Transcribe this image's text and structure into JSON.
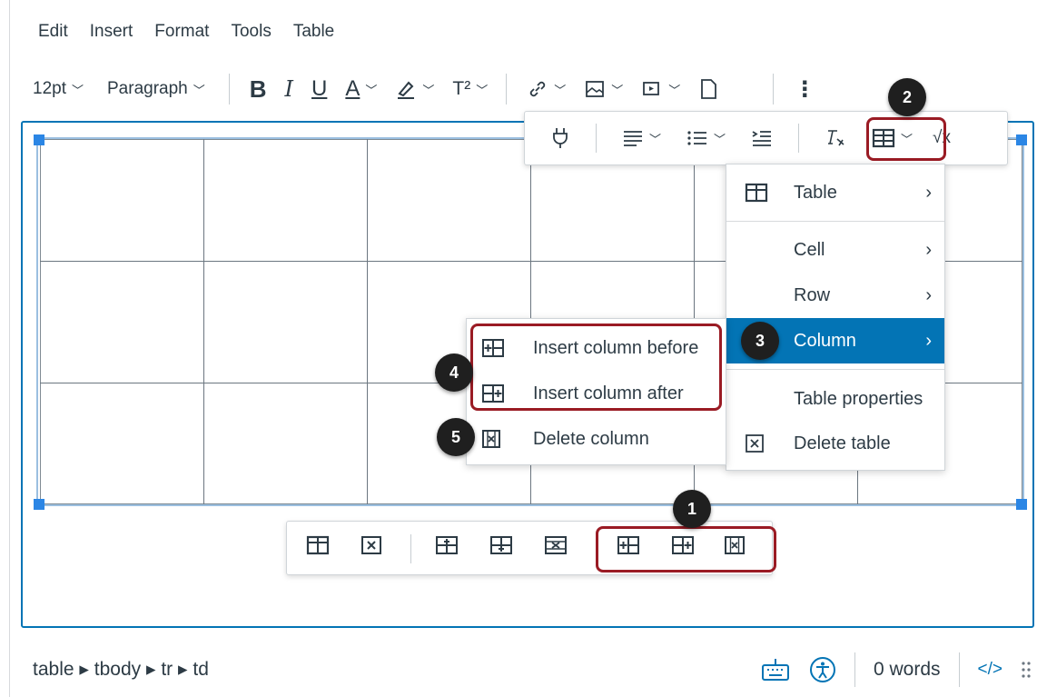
{
  "menubar": {
    "items": [
      "Edit",
      "Insert",
      "Format",
      "Tools",
      "Table"
    ]
  },
  "toolbar": {
    "font_size": "12pt",
    "block_format": "Paragraph",
    "bold": "B",
    "italic": "I",
    "underline": "U",
    "text_color": "A",
    "superscript": "T²",
    "more": "⋮"
  },
  "popup_toolbar": {
    "math": "√x"
  },
  "table_menu": {
    "items": [
      {
        "label": "Table",
        "icon": "table-icon",
        "has_submenu": true
      },
      {
        "label": "Cell",
        "has_submenu": true
      },
      {
        "label": "Row",
        "has_submenu": true
      },
      {
        "label": "Column",
        "has_submenu": true,
        "active": true
      },
      {
        "label": "Table properties",
        "has_submenu": false
      },
      {
        "label": "Delete table",
        "icon": "delete-table-icon",
        "has_submenu": false
      }
    ]
  },
  "column_submenu": {
    "items": [
      {
        "label": "Insert column before",
        "icon": "insert-column-before-icon"
      },
      {
        "label": "Insert column after",
        "icon": "insert-column-after-icon"
      },
      {
        "label": "Delete column",
        "icon": "delete-column-icon"
      }
    ]
  },
  "badges": [
    "1",
    "2",
    "3",
    "4",
    "5"
  ],
  "statusbar": {
    "breadcrumb": "table ▸ tbody ▸ tr ▸ td",
    "word_count": "0 words",
    "html_toggle": "</>"
  },
  "colors": {
    "accent": "#0374b5",
    "highlight": "#9a1b24",
    "text": "#2d3b45"
  }
}
